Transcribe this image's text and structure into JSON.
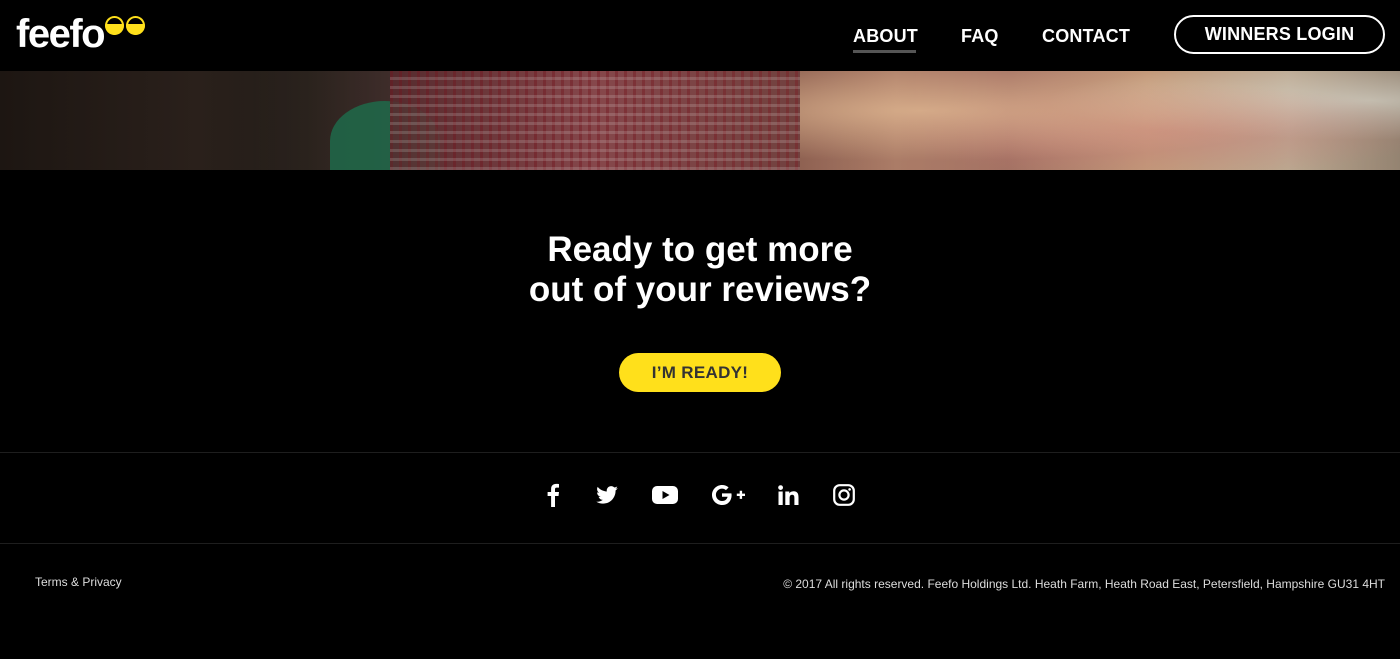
{
  "header": {
    "logo_text": "feefo",
    "nav": {
      "about": "ABOUT",
      "faq": "FAQ",
      "contact": "CONTACT"
    },
    "login_label": "WINNERS LOGIN"
  },
  "hero": {
    "image": "group-of-people-photo"
  },
  "cta": {
    "title_line1": "Ready to get more",
    "title_line2": "out of your reviews?",
    "button_label": "I’M READY!"
  },
  "social": {
    "icons": [
      "facebook-icon",
      "twitter-icon",
      "youtube-icon",
      "google-plus-icon",
      "linkedin-icon",
      "instagram-icon"
    ]
  },
  "footer": {
    "terms_label": "Terms & Privacy",
    "copyright": "© 2017 All rights reserved. Feefo Holdings Ltd. Heath Farm, Heath Road East, Petersfield, Hampshire GU31 4HT"
  },
  "colors": {
    "accent": "#ffe01b",
    "background": "#000000",
    "text": "#ffffff"
  }
}
